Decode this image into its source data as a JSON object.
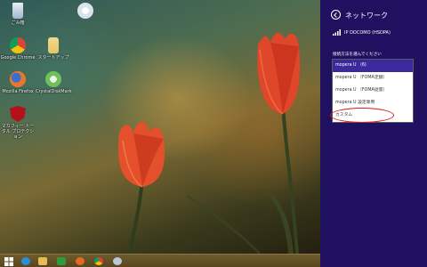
{
  "desktop": {
    "icons": [
      {
        "label": "ごみ箱",
        "icon": "recycle-bin-icon",
        "color": "#9fb7c9"
      },
      {
        "label": "Google Chrome",
        "icon": "chrome-icon",
        "color": "#e0a43a"
      },
      {
        "label": "Mozilla Firefox",
        "icon": "firefox-icon",
        "color": "#d8642a"
      },
      {
        "label": "マカフィー トータル プロテクション",
        "icon": "mcafee-icon",
        "color": "#b3121a"
      },
      {
        "label": "",
        "icon": "network-app-icon",
        "color": "#d8e4f0"
      },
      {
        "label": "スタートアップ",
        "icon": "folder-icon",
        "color": "#e8c56a"
      },
      {
        "label": "CrystalDiskMark",
        "icon": "crystaldiskmark-icon",
        "color": "#6fbf5a"
      }
    ]
  },
  "taskbar": {
    "items": [
      {
        "icon": "windows-start-icon",
        "color": "#ffffff"
      },
      {
        "icon": "internet-explorer-icon",
        "color": "#2a8fd8"
      },
      {
        "icon": "file-explorer-icon",
        "color": "#e6bd53"
      },
      {
        "icon": "store-icon",
        "color": "#2e9b3a"
      },
      {
        "icon": "firefox-icon",
        "color": "#e46a23"
      },
      {
        "icon": "chrome-icon",
        "color": "#e2a33b"
      },
      {
        "icon": "network-connection-icon",
        "color": "#b9c8d4"
      }
    ]
  },
  "charm": {
    "title": "ネットワーク",
    "connection": "IP DOCOMO (HSDPA)",
    "prompt": "接続方法を選んでください",
    "options": [
      "mopera U （6)",
      "mopera U （FOMA定額）",
      "mopera U （FOMA従量）",
      "mopera U 設定専用",
      "カスタム"
    ],
    "selected_index": 0,
    "colors": {
      "background": "#1f1160",
      "accent": "#3b2a9e",
      "highlight": "#d81e1e"
    }
  }
}
